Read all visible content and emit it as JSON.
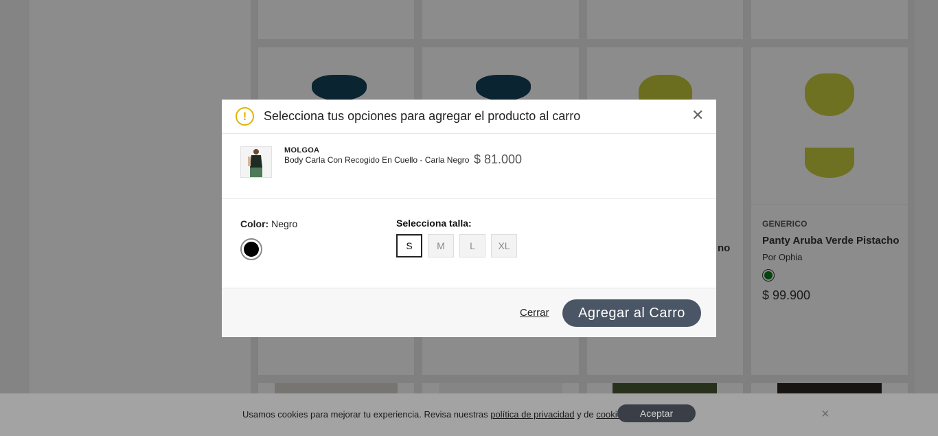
{
  "background": {
    "cards": [
      {
        "brand": "GENERICO",
        "name": "Panty Aruba Verde Pistacho",
        "by": "Por Ophia",
        "price": "$ 99.900",
        "swatch_color": "#0b7a1c"
      },
      {
        "name_partial": "no"
      }
    ]
  },
  "cookie_bar": {
    "text_before": "Usamos cookies para mejorar tu experiencia. Revisa nuestras",
    "privacy_link": "política de privacidad",
    "text_middle": "y de",
    "cookies_link": "cookies",
    "text_end": ".",
    "accept_label": "Aceptar",
    "close_icon": "×"
  },
  "modal": {
    "title": "Selecciona tus opciones para agregar el producto al carro",
    "warning_icon": "!",
    "close_icon": "✕",
    "product": {
      "brand": "MOLGOA",
      "name": "Body Carla Con Recogido En Cuello - Carla Negro",
      "price": "$ 81.000"
    },
    "color": {
      "label": "Color:",
      "value": "Negro",
      "swatch_color": "#000000"
    },
    "size": {
      "label": "Selecciona talla:",
      "options": [
        "S",
        "M",
        "L",
        "XL"
      ],
      "selected": "S"
    },
    "footer": {
      "close_label": "Cerrar",
      "add_label": "Agregar al Carro"
    }
  }
}
